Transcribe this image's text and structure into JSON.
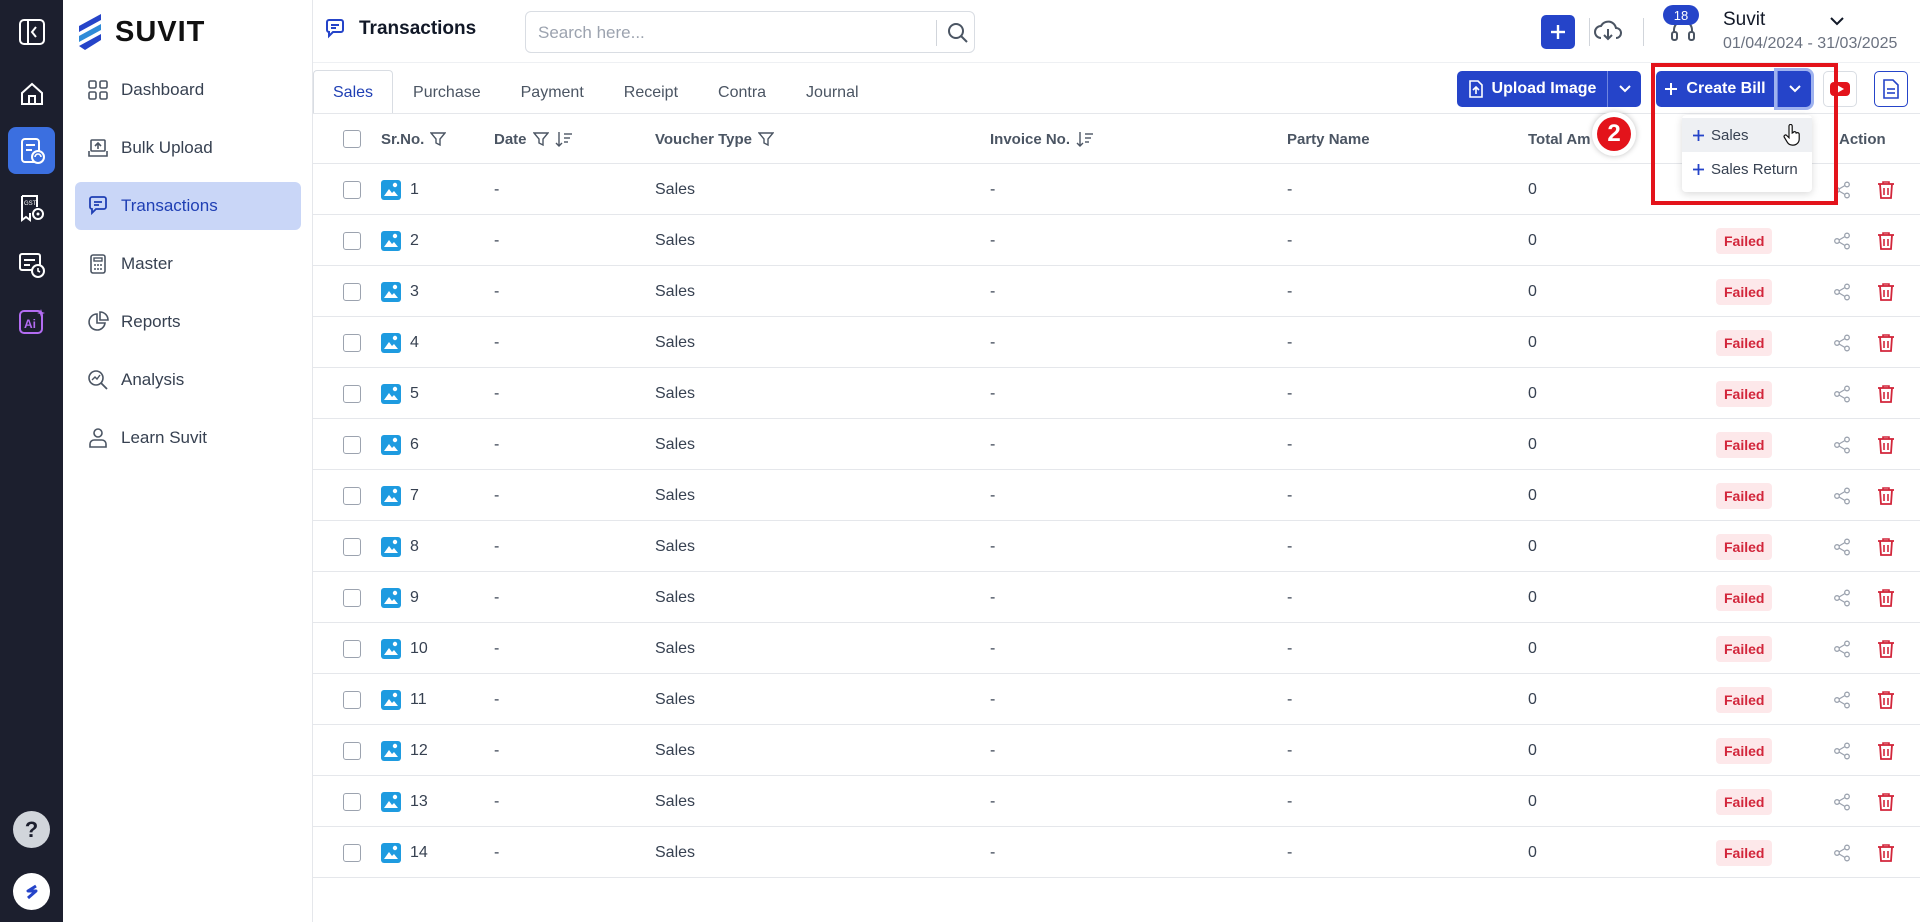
{
  "brand": {
    "name": "SUVIT"
  },
  "sidebar": {
    "items": [
      {
        "label": "Dashboard",
        "icon": "grid-icon",
        "active": false
      },
      {
        "label": "Bulk Upload",
        "icon": "upload-icon",
        "active": false
      },
      {
        "label": "Transactions",
        "icon": "transactions-icon",
        "active": true
      },
      {
        "label": "Master",
        "icon": "calculator-icon",
        "active": false
      },
      {
        "label": "Reports",
        "icon": "pie-chart-icon",
        "active": false
      },
      {
        "label": "Analysis",
        "icon": "analysis-icon",
        "active": false
      },
      {
        "label": "Learn Suvit",
        "icon": "learn-icon",
        "active": false
      }
    ]
  },
  "header": {
    "title": "Transactions",
    "search_placeholder": "Search here...",
    "notification_count": "18",
    "company_name": "Suvit",
    "period": "01/04/2024 - 31/03/2025"
  },
  "tabs": [
    "Sales",
    "Purchase",
    "Payment",
    "Receipt",
    "Contra",
    "Journal"
  ],
  "actions": {
    "upload_label": "Upload Image",
    "create_label": "Create Bill",
    "step_number": "2"
  },
  "create_menu": [
    "Sales",
    "Sales Return"
  ],
  "table": {
    "columns": [
      "Sr.No.",
      "Date",
      "Voucher Type",
      "Invoice No.",
      "Party Name",
      "Total Am",
      "Action"
    ],
    "rows": [
      {
        "sr": "1",
        "date": "-",
        "voucher": "Sales",
        "invoice": "-",
        "party": "-",
        "total": "0",
        "status": ""
      },
      {
        "sr": "2",
        "date": "-",
        "voucher": "Sales",
        "invoice": "-",
        "party": "-",
        "total": "0",
        "status": "Failed"
      },
      {
        "sr": "3",
        "date": "-",
        "voucher": "Sales",
        "invoice": "-",
        "party": "-",
        "total": "0",
        "status": "Failed"
      },
      {
        "sr": "4",
        "date": "-",
        "voucher": "Sales",
        "invoice": "-",
        "party": "-",
        "total": "0",
        "status": "Failed"
      },
      {
        "sr": "5",
        "date": "-",
        "voucher": "Sales",
        "invoice": "-",
        "party": "-",
        "total": "0",
        "status": "Failed"
      },
      {
        "sr": "6",
        "date": "-",
        "voucher": "Sales",
        "invoice": "-",
        "party": "-",
        "total": "0",
        "status": "Failed"
      },
      {
        "sr": "7",
        "date": "-",
        "voucher": "Sales",
        "invoice": "-",
        "party": "-",
        "total": "0",
        "status": "Failed"
      },
      {
        "sr": "8",
        "date": "-",
        "voucher": "Sales",
        "invoice": "-",
        "party": "-",
        "total": "0",
        "status": "Failed"
      },
      {
        "sr": "9",
        "date": "-",
        "voucher": "Sales",
        "invoice": "-",
        "party": "-",
        "total": "0",
        "status": "Failed"
      },
      {
        "sr": "10",
        "date": "-",
        "voucher": "Sales",
        "invoice": "-",
        "party": "-",
        "total": "0",
        "status": "Failed"
      },
      {
        "sr": "11",
        "date": "-",
        "voucher": "Sales",
        "invoice": "-",
        "party": "-",
        "total": "0",
        "status": "Failed"
      },
      {
        "sr": "12",
        "date": "-",
        "voucher": "Sales",
        "invoice": "-",
        "party": "-",
        "total": "0",
        "status": "Failed"
      },
      {
        "sr": "13",
        "date": "-",
        "voucher": "Sales",
        "invoice": "-",
        "party": "-",
        "total": "0",
        "status": "Failed"
      },
      {
        "sr": "14",
        "date": "-",
        "voucher": "Sales",
        "invoice": "-",
        "party": "-",
        "total": "0",
        "status": "Failed"
      }
    ]
  },
  "colors": {
    "accent": "#2544c9",
    "rail": "#1c1f2e",
    "failed": "#d2263b",
    "highlight": "#e3131b",
    "image_icon": "#1e9be0"
  }
}
